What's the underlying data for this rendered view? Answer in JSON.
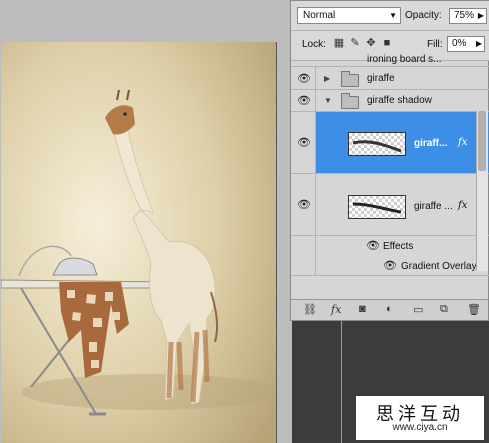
{
  "layers_panel": {
    "blend_mode": "Normal",
    "opacity_label": "Opacity:",
    "opacity_value": "75%",
    "lock_label": "Lock:",
    "fill_label": "Fill:",
    "fill_value": "0%",
    "layers": [
      {
        "name": "ironing board s...",
        "kind": "group",
        "partial": true
      },
      {
        "name": "giraffe",
        "kind": "group",
        "expanded": false
      },
      {
        "name": "giraffe shadow",
        "kind": "group",
        "expanded": true
      },
      {
        "name": "giraff...",
        "kind": "layer",
        "selected": true,
        "fx": "fx"
      },
      {
        "name": "giraffe ...",
        "kind": "layer",
        "selected": false,
        "fx": "fx"
      }
    ],
    "effects_label": "Effects",
    "effect_items": [
      "Gradient Overlay"
    ]
  },
  "watermark": {
    "chinese": "思洋互动",
    "url": "www.ciya.cn"
  },
  "colors": {
    "selected_row": "#3d8ee6",
    "canvas_bg": "#e8dcc0"
  }
}
